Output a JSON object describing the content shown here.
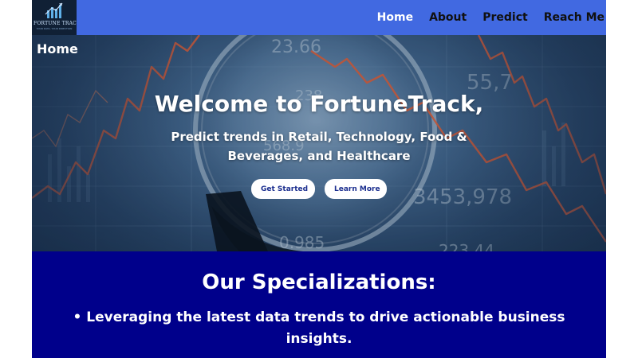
{
  "logo": {
    "name": "FORTUNE TRACK",
    "tagline": "YOUR DATA, YOUR DIRECTION"
  },
  "nav": {
    "items": [
      {
        "label": "Home",
        "active": true
      },
      {
        "label": "About",
        "active": false
      },
      {
        "label": "Predict",
        "active": false
      },
      {
        "label": "Reach Me",
        "active": false
      }
    ]
  },
  "hero": {
    "page_label": "Home",
    "title": "Welcome to FortuneTrack,",
    "subtitle": "Predict trends in Retail, Technology, Food & Beverages, and Healthcare",
    "buttons": {
      "get_started": "Get Started",
      "learn_more": "Learn More"
    },
    "background_numbers": [
      "23.66",
      "55,7",
      "238",
      "568.9",
      "3453,978",
      "0.985",
      "223.44"
    ]
  },
  "specializations": {
    "title": "Our Specializations:",
    "items": [
      "• Leveraging the latest data trends to drive actionable business insights."
    ]
  },
  "colors": {
    "navbar": "#4169e1",
    "section": "#00008b",
    "button_text": "#1c2f8f",
    "trend_line": "#e8623a"
  }
}
